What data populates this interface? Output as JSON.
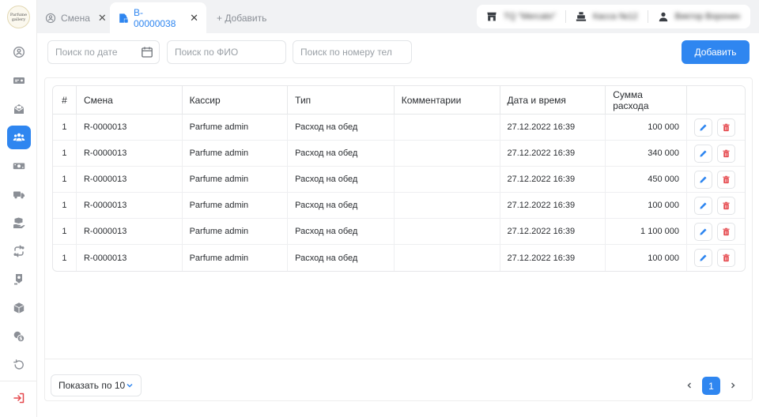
{
  "sidebar": {
    "logo_text": "Parfume Gallery",
    "items": [
      {
        "icon": "cash-register-icon",
        "active": false
      },
      {
        "icon": "money-icon",
        "active": false
      },
      {
        "icon": "envelope-icon",
        "active": false
      },
      {
        "icon": "users-icon",
        "active": true
      },
      {
        "icon": "banknotes-icon",
        "active": false
      },
      {
        "icon": "truck-icon",
        "active": false
      },
      {
        "icon": "hand-box-icon",
        "active": false
      },
      {
        "icon": "exchange-icon",
        "active": false
      },
      {
        "icon": "location-pin-icon",
        "active": false
      },
      {
        "icon": "box-icon",
        "active": false
      },
      {
        "icon": "coins-icon",
        "active": false
      },
      {
        "icon": "undo-icon",
        "active": false
      }
    ],
    "logout_icon": "logout-icon"
  },
  "tabs": [
    {
      "label": "Смена",
      "active": false
    },
    {
      "label": "B-00000038",
      "active": true
    }
  ],
  "add_tab_label": "+ Добавить",
  "info": {
    "store": "TQ \"Mercato\"",
    "register": "Касса №12",
    "user": "Виктор Воронин"
  },
  "filters": {
    "date_placeholder": "Поиск по дате",
    "name_placeholder": "Поиск по ФИО",
    "phone_placeholder": "Поиск по номеру тел"
  },
  "add_button": "Добавить",
  "table": {
    "headers": [
      "#",
      "Смена",
      "Кассир",
      "Тип",
      "Комментарии",
      "Дата и время",
      "Сумма расхода",
      ""
    ],
    "rows": [
      {
        "n": "1",
        "shift": "R-0000013",
        "cashier": "Parfume admin",
        "type": "Расход на обед",
        "comment": "",
        "datetime": "27.12.2022 16:39",
        "amount": "100 000"
      },
      {
        "n": "1",
        "shift": "R-0000013",
        "cashier": "Parfume admin",
        "type": "Расход на обед",
        "comment": "",
        "datetime": "27.12.2022 16:39",
        "amount": "340 000"
      },
      {
        "n": "1",
        "shift": "R-0000013",
        "cashier": "Parfume admin",
        "type": "Расход на обед",
        "comment": "",
        "datetime": "27.12.2022 16:39",
        "amount": "450 000"
      },
      {
        "n": "1",
        "shift": "R-0000013",
        "cashier": "Parfume admin",
        "type": "Расход на обед",
        "comment": "",
        "datetime": "27.12.2022 16:39",
        "amount": "100 000"
      },
      {
        "n": "1",
        "shift": "R-0000013",
        "cashier": "Parfume admin",
        "type": "Расход на обед",
        "comment": "",
        "datetime": "27.12.2022 16:39",
        "amount": "1 100 000"
      },
      {
        "n": "1",
        "shift": "R-0000013",
        "cashier": "Parfume admin",
        "type": "Расход на обед",
        "comment": "",
        "datetime": "27.12.2022 16:39",
        "amount": "100 000"
      }
    ]
  },
  "pagination": {
    "page_size_label": "Показать по 10",
    "current_page": "1"
  },
  "colors": {
    "accent": "#2f86f0",
    "delete": "#e5484d"
  }
}
